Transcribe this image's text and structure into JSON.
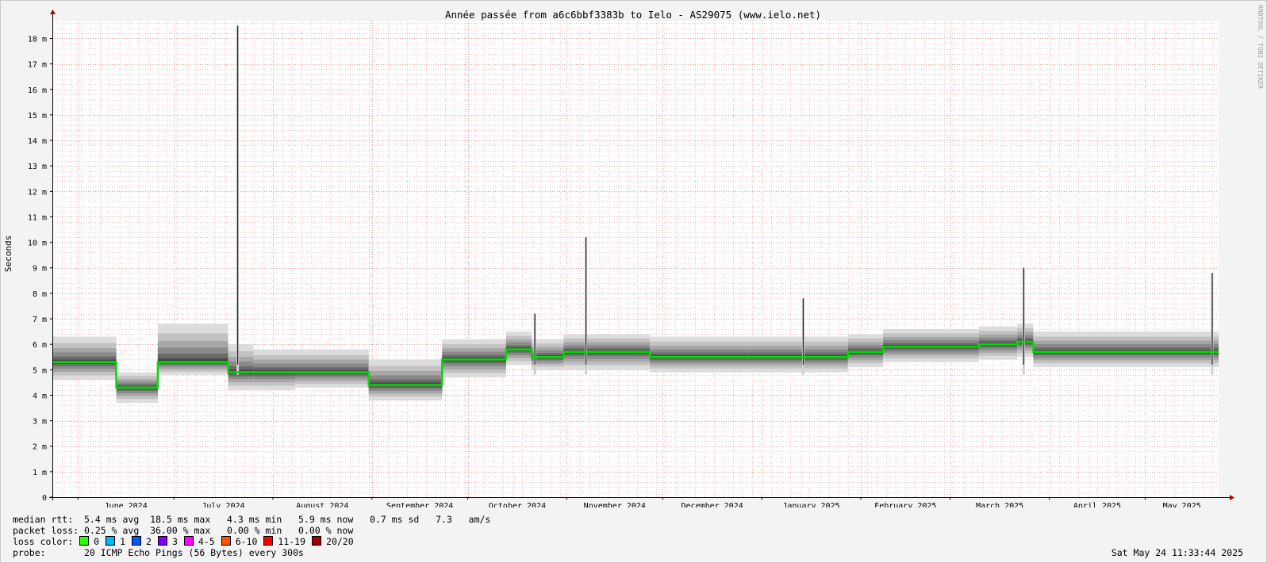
{
  "chart_data": {
    "type": "area",
    "title": "Année passée from a6c6bbf3383b to Ielo - AS29075 (www.ielo.net)",
    "ylabel": "Seconds",
    "watermark": "RRDTOOL / TOBI OETIKER",
    "ylim": [
      0,
      18.7
    ],
    "y_unit": "ms",
    "y_ticks": [
      {
        "v": 0,
        "label": "0"
      },
      {
        "v": 1,
        "label": "1 m"
      },
      {
        "v": 2,
        "label": "2 m"
      },
      {
        "v": 3,
        "label": "3 m"
      },
      {
        "v": 4,
        "label": "4 m"
      },
      {
        "v": 5,
        "label": "5 m"
      },
      {
        "v": 6,
        "label": "6 m"
      },
      {
        "v": 7,
        "label": "7 m"
      },
      {
        "v": 8,
        "label": "8 m"
      },
      {
        "v": 9,
        "label": "9 m"
      },
      {
        "v": 10,
        "label": "10 m"
      },
      {
        "v": 11,
        "label": "11 m"
      },
      {
        "v": 12,
        "label": "12 m"
      },
      {
        "v": 13,
        "label": "13 m"
      },
      {
        "v": 14,
        "label": "14 m"
      },
      {
        "v": 15,
        "label": "15 m"
      },
      {
        "v": 16,
        "label": "16 m"
      },
      {
        "v": 17,
        "label": "17 m"
      },
      {
        "v": 18,
        "label": "18 m"
      }
    ],
    "x_range": [
      "2024-05-24",
      "2025-05-24"
    ],
    "x_ticks": [
      {
        "label": "June 2024",
        "date": "2024-06-01"
      },
      {
        "label": "July 2024",
        "date": "2024-07-01"
      },
      {
        "label": "August 2024",
        "date": "2024-08-01"
      },
      {
        "label": "September 2024",
        "date": "2024-09-01"
      },
      {
        "label": "October 2024",
        "date": "2024-10-01"
      },
      {
        "label": "November 2024",
        "date": "2024-11-01"
      },
      {
        "label": "December 2024",
        "date": "2024-12-01"
      },
      {
        "label": "January 2025",
        "date": "2025-01-01"
      },
      {
        "label": "February 2025",
        "date": "2025-02-01"
      },
      {
        "label": "March 2025",
        "date": "2025-03-01"
      },
      {
        "label": "April 2025",
        "date": "2025-04-01"
      },
      {
        "label": "May 2025",
        "date": "2025-05-01"
      }
    ],
    "median_segments": [
      {
        "from": "2024-05-24",
        "to": "2024-06-13",
        "median": 5.3,
        "min": 4.6,
        "max": 6.3
      },
      {
        "from": "2024-06-13",
        "to": "2024-06-26",
        "median": 4.3,
        "min": 3.7,
        "max": 4.9
      },
      {
        "from": "2024-06-26",
        "to": "2024-07-18",
        "median": 5.3,
        "min": 4.8,
        "max": 6.8
      },
      {
        "from": "2024-07-18",
        "to": "2024-07-26",
        "median": 4.9,
        "min": 4.2,
        "max": 6.0
      },
      {
        "from": "2024-07-26",
        "to": "2024-08-08",
        "median": 4.9,
        "min": 4.2,
        "max": 5.8
      },
      {
        "from": "2024-08-08",
        "to": "2024-08-31",
        "median": 4.9,
        "min": 4.3,
        "max": 5.8
      },
      {
        "from": "2024-08-31",
        "to": "2024-09-23",
        "median": 4.4,
        "min": 3.8,
        "max": 5.4
      },
      {
        "from": "2024-09-23",
        "to": "2024-10-13",
        "median": 5.4,
        "min": 4.7,
        "max": 6.2
      },
      {
        "from": "2024-10-13",
        "to": "2024-10-21",
        "median": 5.8,
        "min": 5.2,
        "max": 6.5
      },
      {
        "from": "2024-10-21",
        "to": "2024-10-31",
        "median": 5.5,
        "min": 5.0,
        "max": 6.2
      },
      {
        "from": "2024-10-31",
        "to": "2024-11-27",
        "median": 5.7,
        "min": 5.0,
        "max": 6.4
      },
      {
        "from": "2024-11-27",
        "to": "2024-12-28",
        "median": 5.5,
        "min": 4.9,
        "max": 6.3
      },
      {
        "from": "2024-12-28",
        "to": "2025-01-28",
        "median": 5.5,
        "min": 4.9,
        "max": 6.3
      },
      {
        "from": "2025-01-28",
        "to": "2025-02-08",
        "median": 5.7,
        "min": 5.1,
        "max": 6.4
      },
      {
        "from": "2025-02-08",
        "to": "2025-03-10",
        "median": 5.9,
        "min": 5.3,
        "max": 6.6
      },
      {
        "from": "2025-03-10",
        "to": "2025-03-22",
        "median": 6.0,
        "min": 5.4,
        "max": 6.7
      },
      {
        "from": "2025-03-22",
        "to": "2025-03-27",
        "median": 6.1,
        "min": 5.5,
        "max": 6.8
      },
      {
        "from": "2025-03-27",
        "to": "2025-05-24",
        "median": 5.7,
        "min": 5.1,
        "max": 6.5
      }
    ],
    "spikes": [
      {
        "date": "2024-07-21",
        "value": 18.5
      },
      {
        "date": "2024-10-22",
        "value": 7.2
      },
      {
        "date": "2024-11-07",
        "value": 10.2
      },
      {
        "date": "2025-01-14",
        "value": 7.8
      },
      {
        "date": "2025-03-24",
        "value": 9.0
      },
      {
        "date": "2025-05-22",
        "value": 8.8
      }
    ],
    "colors": {
      "background": "#f3f3f3",
      "plot_bg": "#ffffff",
      "grid_minor": "#f2c8c8",
      "grid_major": "#e69999",
      "axis": "#000000",
      "arrow": "#aa0000",
      "median": "#00dd00",
      "smoke_light": "#d4d4d4",
      "smoke_dark": "#555555"
    }
  },
  "stats": {
    "median_rtt": "median rtt:  5.4 ms avg  18.5 ms max   4.3 ms min   5.9 ms now   0.7 ms sd   7.3   am/s",
    "packet_loss": "packet loss: 0.25 % avg  36.00 % max   0.00 % min   0.00 % now",
    "loss_color_label": "loss color:",
    "loss_colors": [
      {
        "label": "0",
        "color": "#26ff00"
      },
      {
        "label": "1",
        "color": "#00b8ff"
      },
      {
        "label": "2",
        "color": "#0059ff"
      },
      {
        "label": "3",
        "color": "#7e00ff"
      },
      {
        "label": "4-5",
        "color": "#ff00ff"
      },
      {
        "label": "6-10",
        "color": "#ff5500"
      },
      {
        "label": "11-19",
        "color": "#ff0000"
      },
      {
        "label": "20/20",
        "color": "#a10000"
      }
    ],
    "probe": "probe:       20 ICMP Echo Pings (56 Bytes) every 300s",
    "timestamp": "Sat May 24 11:33:44 2025"
  }
}
